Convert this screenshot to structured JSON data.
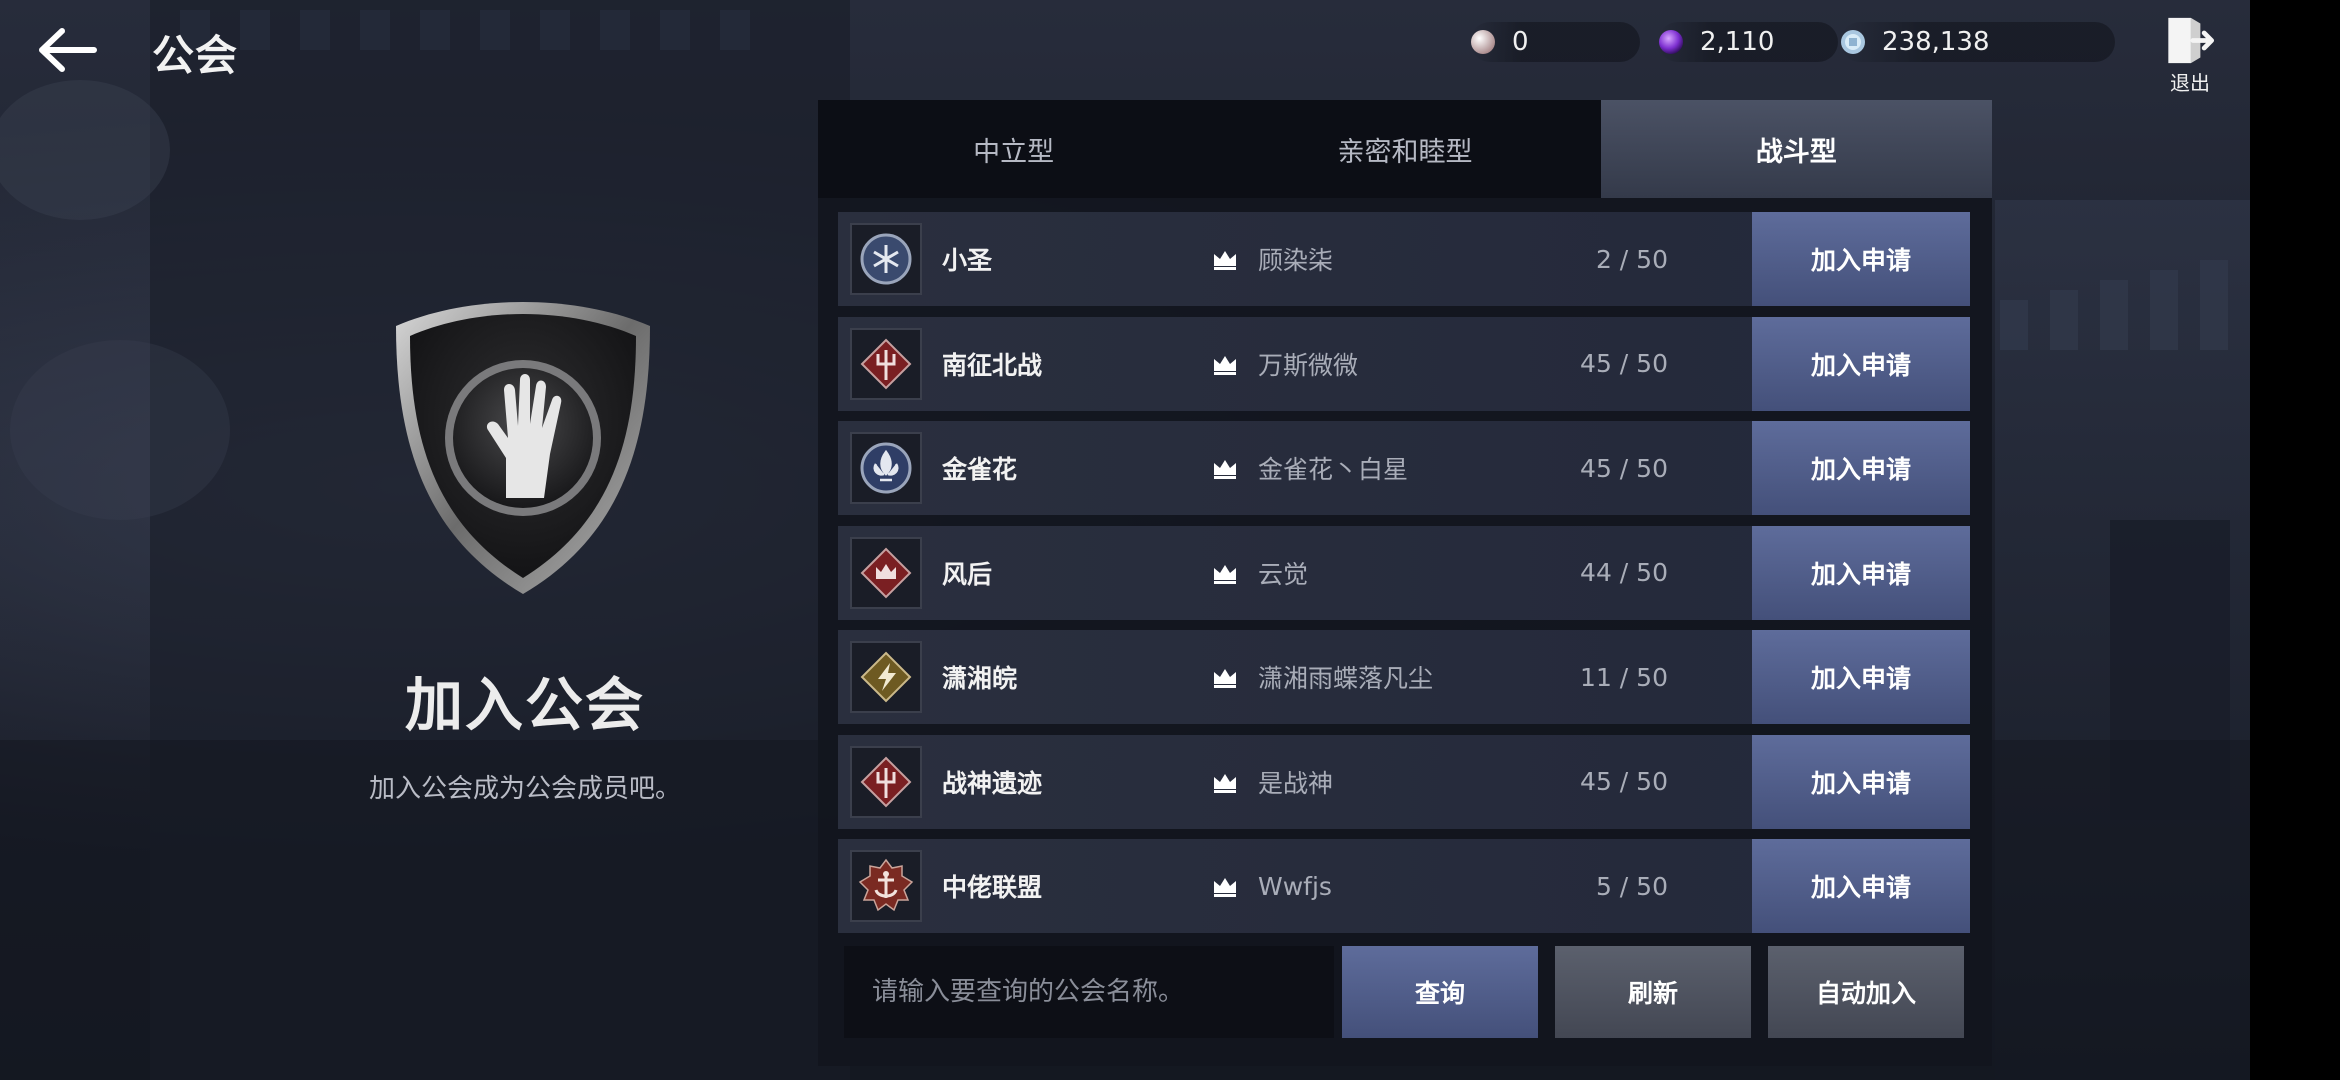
{
  "header": {
    "title": "公会",
    "back_icon": "arrow-left-icon",
    "exit_label": "退出"
  },
  "currencies": [
    {
      "icon": "pearl-icon",
      "value": "0",
      "color": "#d8c8c4"
    },
    {
      "icon": "purple-gem-icon",
      "value": "2,110",
      "color": "#8a3fd6"
    },
    {
      "icon": "crystal-coin-icon",
      "value": "238,138",
      "color": "#bcd8ee"
    }
  ],
  "left_panel": {
    "title": "加入公会",
    "subtitle": "加入公会成为公会成员吧。"
  },
  "tabs": [
    {
      "label": "中立型",
      "active": false
    },
    {
      "label": "亲密和睦型",
      "active": false
    },
    {
      "label": "战斗型",
      "active": true
    }
  ],
  "guilds": [
    {
      "name": "小圣",
      "leader": "顾染柒",
      "members": "2 / 50",
      "emblem_color": "#3a4a6e",
      "emblem_icon": "snowflake-emblem-icon"
    },
    {
      "name": "南征北战",
      "leader": "万斯微微",
      "members": "45 / 50",
      "emblem_color": "#7a1f22",
      "emblem_icon": "trident-emblem-icon"
    },
    {
      "name": "金雀花",
      "leader": "金雀花丶白星",
      "members": "45 / 50",
      "emblem_color": "#2f3e66",
      "emblem_icon": "fleur-emblem-icon"
    },
    {
      "name": "风后",
      "leader": "云觉",
      "members": "44 / 50",
      "emblem_color": "#7a1f22",
      "emblem_icon": "crown-emblem-icon"
    },
    {
      "name": "潇湘皖",
      "leader": "潇湘雨蝶落凡尘",
      "members": "11 / 50",
      "emblem_color": "#6e5a22",
      "emblem_icon": "lightning-emblem-icon"
    },
    {
      "name": "战神遗迹",
      "leader": "是战神",
      "members": "45 / 50",
      "emblem_color": "#7a1f22",
      "emblem_icon": "trident-emblem-icon"
    },
    {
      "name": "中佬联盟",
      "leader": "Wwfjs",
      "members": "5 / 50",
      "emblem_color": "#7a2a22",
      "emblem_icon": "anchor-emblem-icon"
    }
  ],
  "apply_label": "加入申请",
  "search": {
    "placeholder": "请输入要查询的公会名称。",
    "value": ""
  },
  "buttons": {
    "query": "查询",
    "refresh": "刷新",
    "auto_join": "自动加入"
  }
}
